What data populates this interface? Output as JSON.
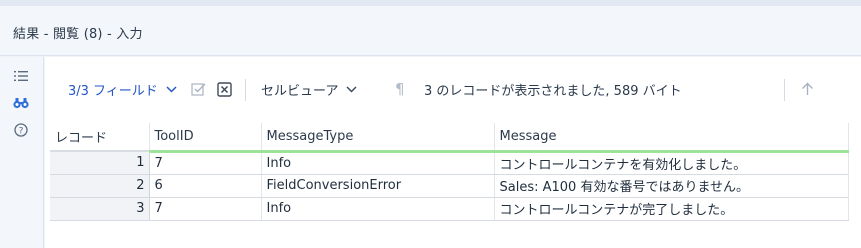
{
  "window": {
    "title": "結果 - 閲覧 (8) - 入力"
  },
  "sidebar": {
    "icons": [
      "list-icon",
      "binoculars-icon",
      "help-icon"
    ]
  },
  "toolbar": {
    "fields_label": "3/3 フィールド",
    "viewer_label": "セルビューア",
    "status_text": "3 のレコードが表示されました, 589 バイト"
  },
  "grid": {
    "columns": [
      "レコード",
      "ToolID",
      "MessageType",
      "Message"
    ],
    "rows": [
      {
        "record": "1",
        "toolid": "7",
        "type": "Info",
        "message": "コントロールコンテナを有効化しました。"
      },
      {
        "record": "2",
        "toolid": "6",
        "type": "FieldConversionError",
        "message": "Sales: A100 有効な番号ではありません。"
      },
      {
        "record": "3",
        "toolid": "7",
        "type": "Info",
        "message": "コントロールコンテナが完了しました。"
      }
    ]
  },
  "colors": {
    "accent": "#2356c7",
    "header_underline": "#9ee39a",
    "sidebar_active": "#2e6fd8"
  }
}
